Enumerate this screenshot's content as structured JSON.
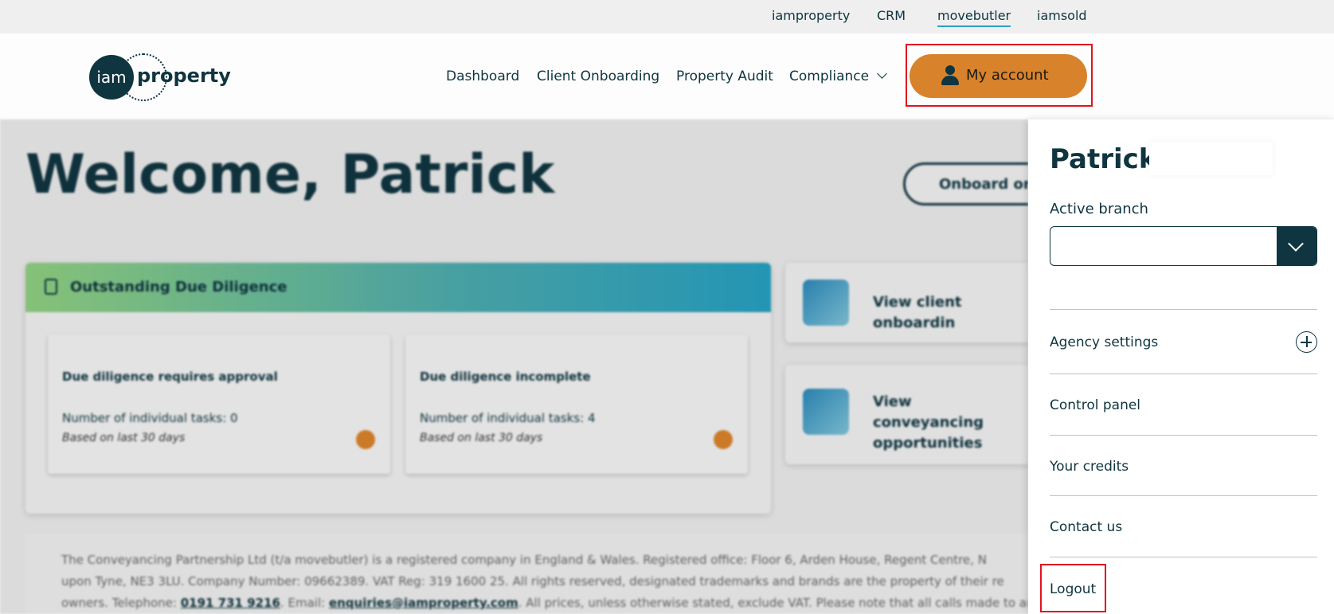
{
  "brand_bar": {
    "links": [
      {
        "label": "iamproperty"
      },
      {
        "label": "CRM"
      },
      {
        "label": "movebutler",
        "active": true
      },
      {
        "label": "iamsold"
      }
    ]
  },
  "header": {
    "logo": {
      "mark": "iam",
      "word": "property"
    },
    "nav": [
      {
        "label": "Dashboard"
      },
      {
        "label": "Client Onboarding"
      },
      {
        "label": "Property Audit"
      },
      {
        "label": "Compliance"
      }
    ],
    "account_button": {
      "label": "My account",
      "icon": "person-icon",
      "color": "#d8832b"
    }
  },
  "main": {
    "welcome": "Welcome, Patrick",
    "onboard_button": "Onboard or",
    "due_diligence": {
      "title": "Outstanding Due Diligence",
      "cards": [
        {
          "title": "Due diligence requires approval",
          "count": "Number of individual tasks: 0",
          "basis": "Based on last 30 days"
        },
        {
          "title": "Due diligence incomplete",
          "count": "Number of individual tasks: 4",
          "basis": "Based on last 30 days"
        }
      ]
    },
    "side_cards": [
      {
        "label": "View client onboardin"
      },
      {
        "label": "View conveyancing opportunities"
      }
    ],
    "footer": {
      "text1": "The Conveyancing Partnership Ltd (t/a movebutler) is a registered company in England & Wales. Registered office: Floor 6, Arden House, Regent Centre, N",
      "text2": "upon Tyne, NE3 3LU. Company Number: 09662389. VAT Reg: 319 1600 25. All rights reserved, designated trademarks and brands are the property of their re",
      "text3_pre": "owners. Telephone: ",
      "phone": "0191 731 9216",
      "text3_mid": ". Email: ",
      "email": "enquiries@iamproperty.com",
      "text3_post": ". All prices, unless otherwise stated, exclude VAT. Please note that all calls made to an"
    }
  },
  "account_panel": {
    "name": "Patrick",
    "active_branch_label": "Active branch",
    "branch_value": "",
    "items": [
      {
        "label": "Agency settings"
      },
      {
        "label": "Control panel"
      },
      {
        "label": "Your credits"
      },
      {
        "label": "Contact us"
      },
      {
        "label": "Logout"
      }
    ]
  },
  "colors": {
    "accent": "#d8832b",
    "brand_dark": "#0f3540",
    "highlight": "#e0141e"
  }
}
